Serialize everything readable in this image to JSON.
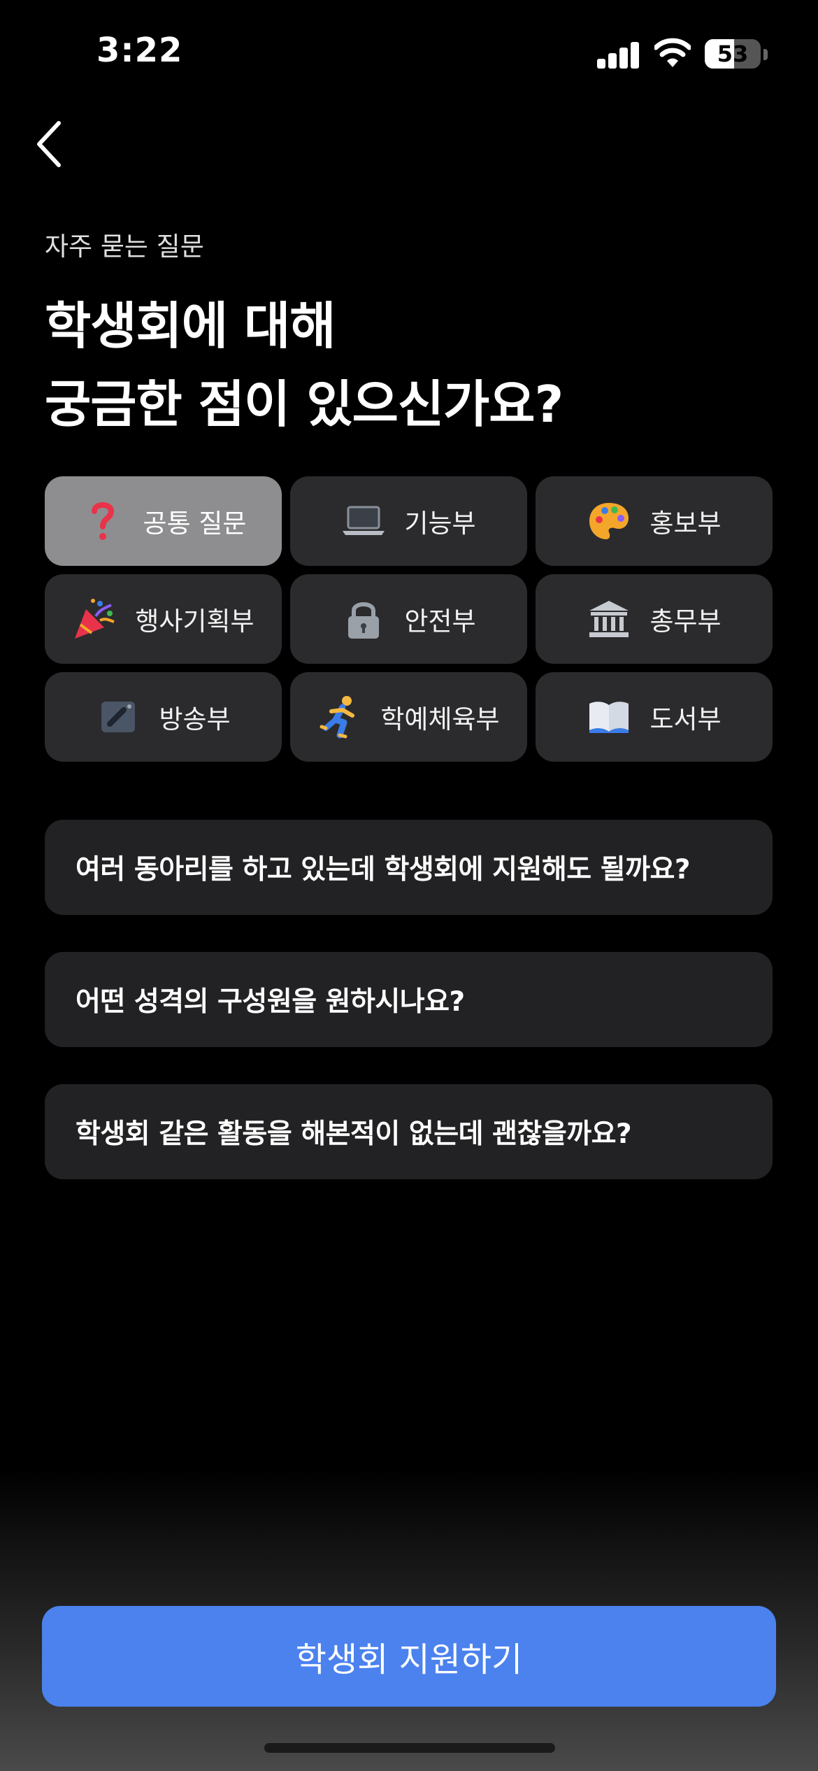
{
  "status_bar": {
    "time": "3:22",
    "battery_level": "53",
    "battery_fraction": 0.53
  },
  "header": {
    "back_icon": "chevron-left-icon",
    "subtitle": "자주 묻는 질문",
    "title_line1": "학생회에 대해",
    "title_line2": "궁금한 점이 있으신가요?"
  },
  "categories": [
    {
      "label": "공통 질문",
      "icon": "question-mark-icon",
      "selected": true
    },
    {
      "label": "기능부",
      "icon": "laptop-icon",
      "selected": false
    },
    {
      "label": "홍보부",
      "icon": "palette-icon",
      "selected": false
    },
    {
      "label": "행사기획부",
      "icon": "party-popper-icon",
      "selected": false
    },
    {
      "label": "안전부",
      "icon": "lock-icon",
      "selected": false
    },
    {
      "label": "총무부",
      "icon": "bank-icon",
      "selected": false
    },
    {
      "label": "방송부",
      "icon": "broadcast-icon",
      "selected": false
    },
    {
      "label": "학예체육부",
      "icon": "runner-icon",
      "selected": false
    },
    {
      "label": "도서부",
      "icon": "book-icon",
      "selected": false
    }
  ],
  "faqs": [
    {
      "question": "여러 동아리를 하고 있는데 학생회에 지원해도 될까요?"
    },
    {
      "question": "어떤 성격의 구성원을 원하시나요?"
    },
    {
      "question": "학생회 같은 활동을 해본적이 없는데 괜찮을까요?"
    }
  ],
  "cta": {
    "label": "학생회 지원하기"
  },
  "colors": {
    "background": "#000000",
    "chip": "#2b2b2d",
    "chip_selected": "#8e8e90",
    "faq_card": "#222224",
    "cta": "#4b82ee"
  }
}
